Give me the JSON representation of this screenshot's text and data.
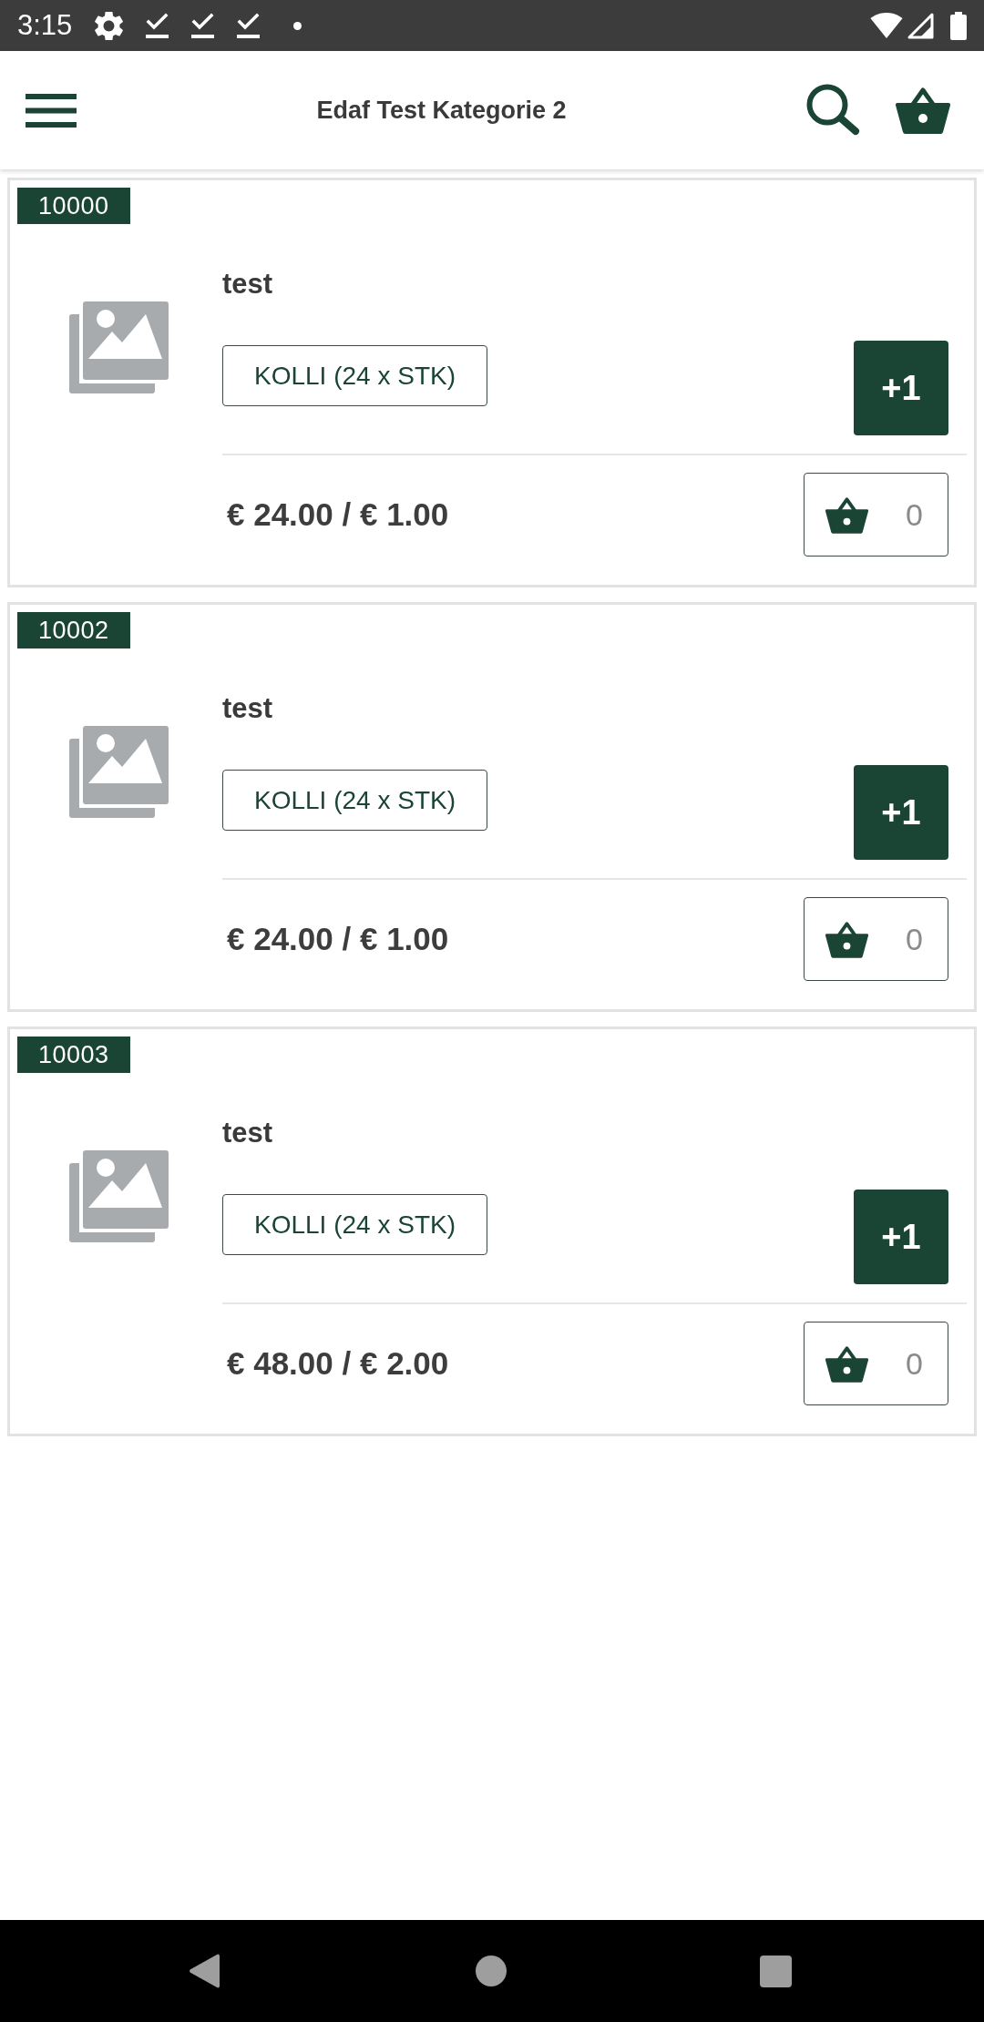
{
  "status_bar": {
    "time": "3:15"
  },
  "app_bar": {
    "title": "Edaf Test Kategorie 2"
  },
  "products": [
    {
      "number": "10000",
      "name": "test",
      "unit": "KOLLI (24 x STK)",
      "add_label": "+1",
      "price": "€ 24.00 / € 1.00",
      "cart_quantity": "0"
    },
    {
      "number": "10002",
      "name": "test",
      "unit": "KOLLI (24 x STK)",
      "add_label": "+1",
      "price": "€ 24.00 / € 1.00",
      "cart_quantity": "0"
    },
    {
      "number": "10003",
      "name": "test",
      "unit": "KOLLI (24 x STK)",
      "add_label": "+1",
      "price": "€ 48.00 / € 2.00",
      "cart_quantity": "0"
    }
  ]
}
